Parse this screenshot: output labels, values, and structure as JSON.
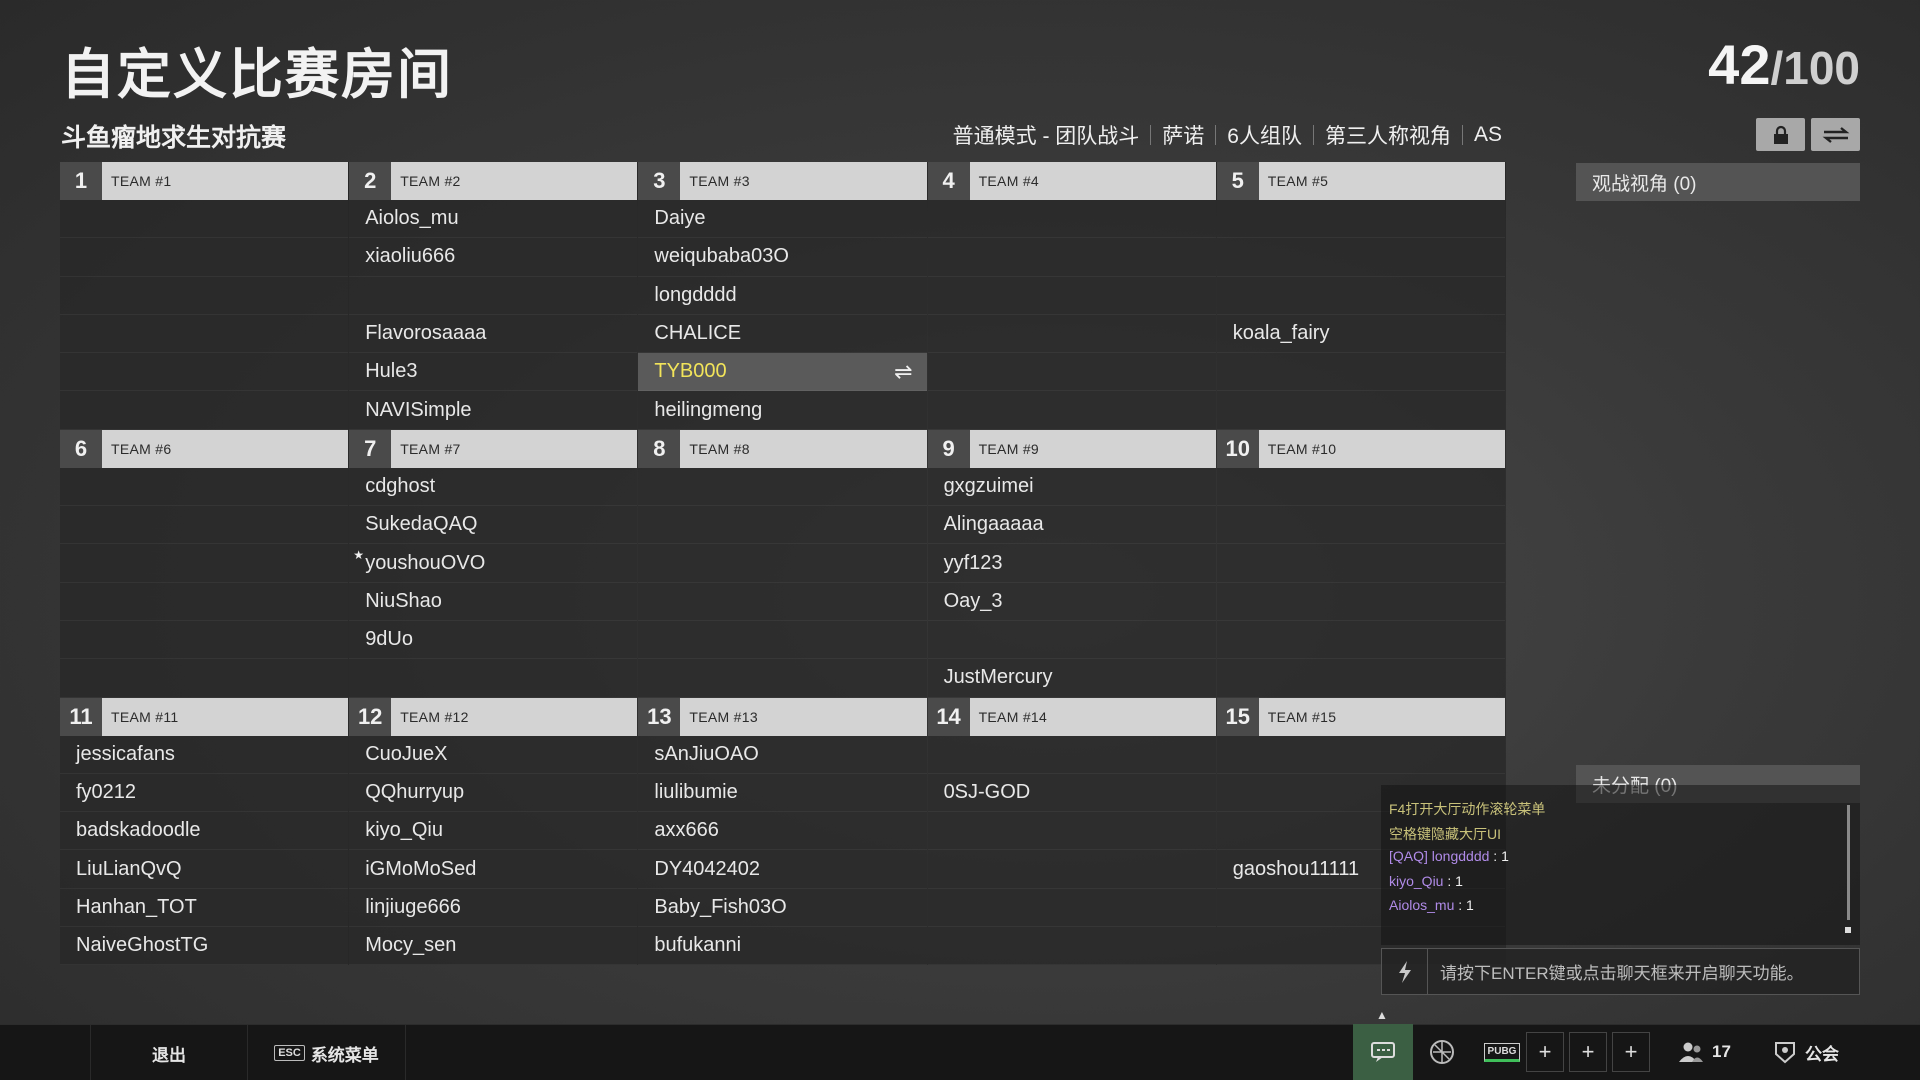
{
  "header": {
    "title": "自定义比赛房间",
    "player_count": "42",
    "player_capacity": "/100",
    "subtitle": "斗鱼瘤地求生对抗赛",
    "modes": [
      "普通模式 - 团队战斗",
      "萨诺",
      "6人组队",
      "第三人称视角",
      "AS"
    ]
  },
  "teams": [
    {
      "num": "1",
      "name": "TEAM #1",
      "players": [
        "",
        "",
        "",
        "",
        "",
        ""
      ]
    },
    {
      "num": "2",
      "name": "TEAM #2",
      "players": [
        "Aiolos_mu",
        "xiaoliu666",
        "",
        "Flavorosaaaa",
        "Hule3",
        "NAVISimple"
      ]
    },
    {
      "num": "3",
      "name": "TEAM #3",
      "players": [
        "Daiye",
        "weiqubaba03O",
        "longdddd",
        "CHALICE",
        "TYB000",
        "heilingmeng"
      ]
    },
    {
      "num": "4",
      "name": "TEAM #4",
      "players": [
        "",
        "",
        "",
        "",
        "",
        ""
      ]
    },
    {
      "num": "5",
      "name": "TEAM #5",
      "players": [
        "",
        "",
        "",
        "koala_fairy",
        "",
        ""
      ]
    },
    {
      "num": "6",
      "name": "TEAM #6",
      "players": [
        "",
        "",
        "",
        "",
        "",
        ""
      ]
    },
    {
      "num": "7",
      "name": "TEAM #7",
      "players": [
        "cdghost",
        "SukedaQAQ",
        "youshouOVO",
        "NiuShao",
        "9dUo",
        ""
      ]
    },
    {
      "num": "8",
      "name": "TEAM #8",
      "players": [
        "",
        "",
        "",
        "",
        "",
        ""
      ]
    },
    {
      "num": "9",
      "name": "TEAM #9",
      "players": [
        "gxgzuimei",
        "Alingaaaaa",
        "yyf123",
        "Oay_3",
        "",
        "JustMercury"
      ]
    },
    {
      "num": "10",
      "name": "TEAM #10",
      "players": [
        "",
        "",
        "",
        "",
        "",
        ""
      ]
    },
    {
      "num": "11",
      "name": "TEAM #11",
      "players": [
        "jessicafans",
        "fy0212",
        "badskadoodle",
        "LiuLianQvQ",
        "Hanhan_TOT",
        "NaiveGhostTG"
      ]
    },
    {
      "num": "12",
      "name": "TEAM #12",
      "players": [
        "CuoJueX",
        "QQhurryup",
        "kiyo_Qiu",
        "iGMoMoSed",
        "linjiuge666",
        "Mocy_sen"
      ]
    },
    {
      "num": "13",
      "name": "TEAM #13",
      "players": [
        "sAnJiuOAO",
        "liulibumie",
        "axx666",
        "DY4042402",
        "Baby_Fish03O",
        "bufukanni"
      ]
    },
    {
      "num": "14",
      "name": "TEAM #14",
      "players": [
        "",
        "0SJ-GOD",
        "",
        "",
        "",
        ""
      ]
    },
    {
      "num": "15",
      "name": "TEAM #15",
      "players": [
        "",
        "",
        "",
        "gaoshou11111",
        "",
        ""
      ]
    }
  ],
  "highlight": {
    "team": 2,
    "slot": 4
  },
  "star": {
    "team": 6,
    "slot": 2
  },
  "side_panels": {
    "spectator": "观战视角 (0)",
    "unassigned": "未分配 (0)"
  },
  "chat": {
    "messages": [
      {
        "name": "",
        "text": "F4打开大厅动作滚轮菜单",
        "color": "#c9c27a"
      },
      {
        "name": "",
        "text": "空格键隐藏大厅UI",
        "color": "#c9c27a"
      },
      {
        "name": "[QAQ] longdddd",
        "text": " : 1",
        "color": "#b08be8"
      },
      {
        "name": "kiyo_Qiu",
        "text": " : 1",
        "color": "#b08be8"
      },
      {
        "name": "Aiolos_mu",
        "text": " : 1",
        "color": "#b08be8"
      }
    ],
    "input_placeholder": "请按下ENTER键或点击聊天框来开启聊天功能。"
  },
  "bottom_bar": {
    "exit_label": "退出",
    "esc_key": "ESC",
    "menu_label": "系统菜单",
    "pubg_label": "PUBG",
    "friends_count": "17",
    "guild_label": "公会"
  },
  "colors": {
    "highlight_text": "#f2e45a",
    "chat_name": "#b08be8",
    "chat_system": "#c9c27a",
    "chat_active": "#3b5f43"
  }
}
